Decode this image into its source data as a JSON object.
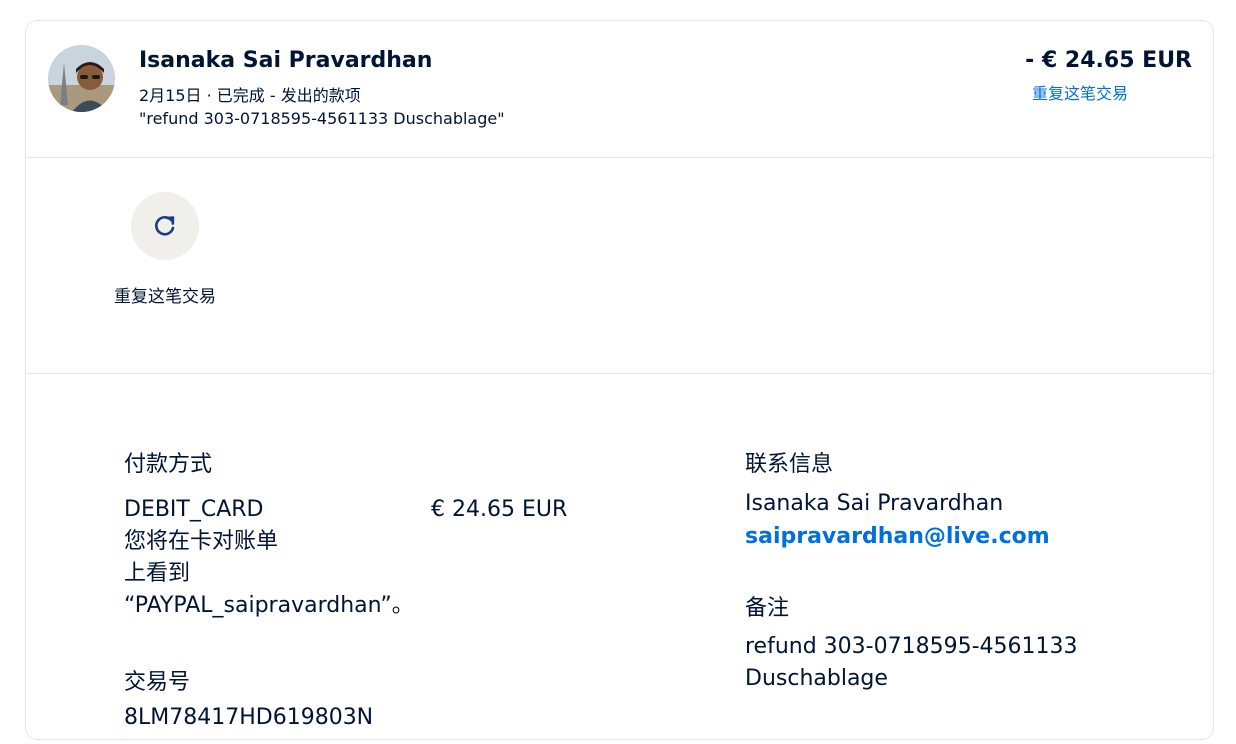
{
  "header": {
    "name": "Isanaka Sai Pravardhan",
    "subline": "2月15日 · 已完成 - 发出的款项",
    "note": "\"refund 303-0718595-4561133 Duschablage\"",
    "amount": "- € 24.65 EUR",
    "repeat_link": "重复这笔交易"
  },
  "actions": {
    "repeat_label": "重复这笔交易",
    "repeat_icon": "refresh-icon",
    "accent": "#1b3a8c"
  },
  "payment": {
    "heading": "付款方式",
    "method": "DEBIT_CARD",
    "amount": "€ 24.65 EUR",
    "statement_line1": "您将在卡对账单",
    "statement_line2": "上看到",
    "statement_line3": "“PAYPAL_saipravardhan”。"
  },
  "transaction": {
    "heading": "交易号",
    "id": "8LM78417HD619803N"
  },
  "contact": {
    "heading": "联系信息",
    "name": "Isanaka Sai Pravardhan",
    "email": "saipravardhan@live.com"
  },
  "memo": {
    "heading": "备注",
    "line1": "refund 303-0718595-4561133",
    "line2": "Duschablage"
  },
  "colors": {
    "text": "#001435",
    "link": "#0070e0",
    "border": "#e6e6e6",
    "button_bg": "#f1efea"
  }
}
